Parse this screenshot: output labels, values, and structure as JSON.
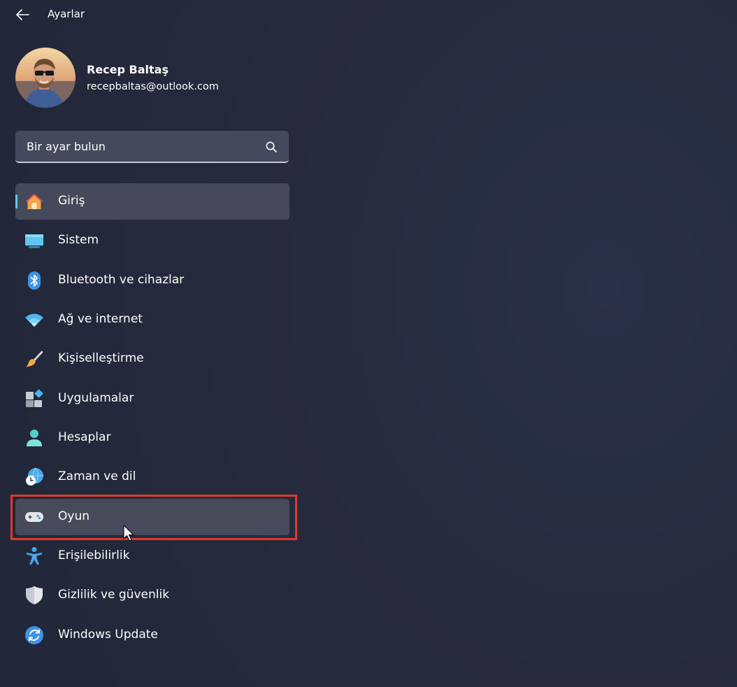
{
  "window": {
    "title": "Ayarlar"
  },
  "profile": {
    "name": "Recep Baltaş",
    "email": "recepbaltas@outlook.com"
  },
  "search": {
    "placeholder": "Bir ayar bulun",
    "value": ""
  },
  "nav": {
    "items": [
      {
        "label": "Giriş",
        "icon": "home-icon"
      },
      {
        "label": "Sistem",
        "icon": "monitor-icon"
      },
      {
        "label": "Bluetooth ve cihazlar",
        "icon": "bluetooth-icon"
      },
      {
        "label": "Ağ ve internet",
        "icon": "wifi-icon"
      },
      {
        "label": "Kişiselleştirme",
        "icon": "paintbrush-icon"
      },
      {
        "label": "Uygulamalar",
        "icon": "apps-icon"
      },
      {
        "label": "Hesaplar",
        "icon": "person-icon"
      },
      {
        "label": "Zaman ve dil",
        "icon": "globe-clock-icon"
      },
      {
        "label": "Oyun",
        "icon": "gamepad-icon"
      },
      {
        "label": "Erişilebilirlik",
        "icon": "accessibility-icon"
      },
      {
        "label": "Gizlilik ve güvenlik",
        "icon": "shield-icon"
      },
      {
        "label": "Windows Update",
        "icon": "update-icon"
      }
    ],
    "selected": "Giriş",
    "hovered": "Oyun"
  },
  "colors": {
    "accent": "#5fc8f5",
    "highlight": "#e0392b",
    "background": "#262b3d"
  }
}
